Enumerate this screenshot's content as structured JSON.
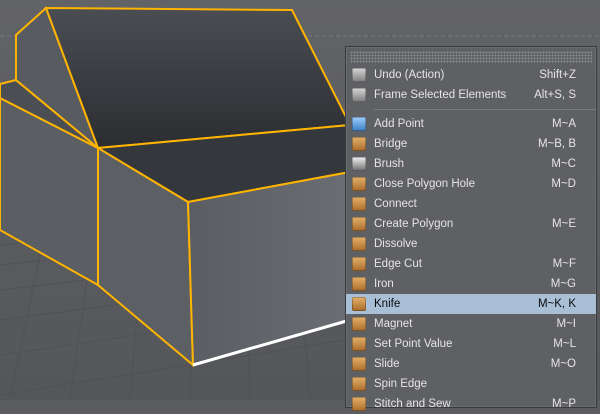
{
  "menu": {
    "items": [
      {
        "label": "Undo (Action)",
        "shortcut": "Shift+Z",
        "icon": "undo-icon"
      },
      {
        "label": "Frame Selected Elements",
        "shortcut": "Alt+S, S",
        "icon": "frame-selected-icon"
      },
      {
        "label": "Add Point",
        "shortcut": "M~A",
        "icon": "add-point-icon"
      },
      {
        "label": "Bridge",
        "shortcut": "M~B, B",
        "icon": "bridge-icon"
      },
      {
        "label": "Brush",
        "shortcut": "M~C",
        "icon": "brush-icon"
      },
      {
        "label": "Close Polygon Hole",
        "shortcut": "M~D",
        "icon": "close-polygon-hole-icon"
      },
      {
        "label": "Connect",
        "shortcut": "",
        "icon": "connect-icon"
      },
      {
        "label": "Create Polygon",
        "shortcut": "M~E",
        "icon": "create-polygon-icon"
      },
      {
        "label": "Dissolve",
        "shortcut": "",
        "icon": "dissolve-icon"
      },
      {
        "label": "Edge Cut",
        "shortcut": "M~F",
        "icon": "edge-cut-icon"
      },
      {
        "label": "Iron",
        "shortcut": "M~G",
        "icon": "iron-icon"
      },
      {
        "label": "Knife",
        "shortcut": "M~K, K",
        "icon": "knife-icon",
        "selected": true
      },
      {
        "label": "Magnet",
        "shortcut": "M~I",
        "icon": "magnet-icon"
      },
      {
        "label": "Set Point Value",
        "shortcut": "M~L",
        "icon": "set-point-value-icon"
      },
      {
        "label": "Slide",
        "shortcut": "M~O",
        "icon": "slide-icon"
      },
      {
        "label": "Spin Edge",
        "shortcut": "",
        "icon": "spin-edge-icon"
      },
      {
        "label": "Stitch and Sew",
        "shortcut": "M~P",
        "icon": "stitch-and-sew-icon"
      }
    ]
  },
  "colors": {
    "selection_highlight": "#a8bfd6",
    "edge_highlight": "#ffb400",
    "viewport_background": "#5b5c5f"
  }
}
